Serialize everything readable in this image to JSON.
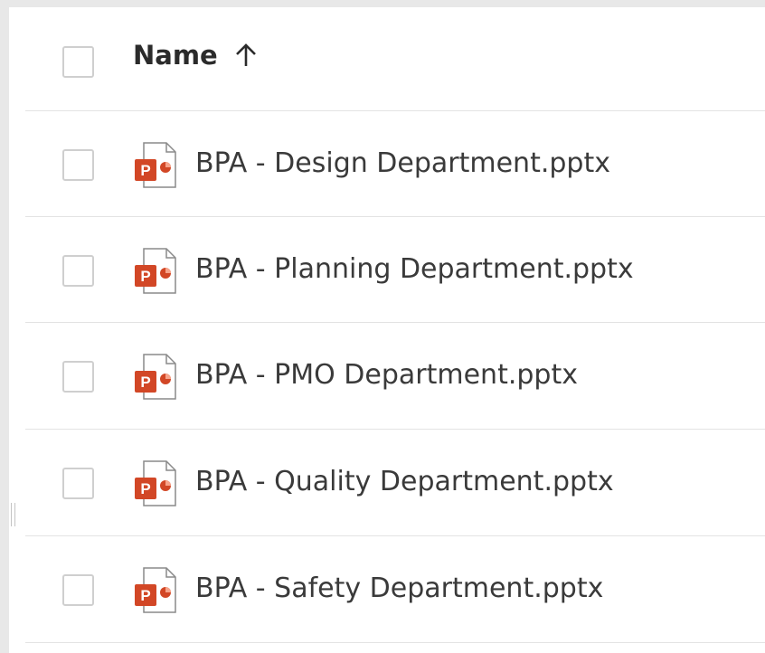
{
  "header": {
    "name_label": "Name",
    "sort_direction_icon": "arrow-up-icon"
  },
  "file_icon": "powerpoint-file-icon",
  "files": [
    {
      "name": "BPA - Design Department.pptx"
    },
    {
      "name": "BPA - Planning Department.pptx"
    },
    {
      "name": "BPA - PMO Department.pptx"
    },
    {
      "name": "BPA - Quality Department.pptx"
    },
    {
      "name": "BPA - Safety Department.pptx"
    }
  ],
  "colors": {
    "powerpoint_red": "#d24726",
    "text": "#3a3a3a",
    "divider": "#e3e3e3"
  }
}
